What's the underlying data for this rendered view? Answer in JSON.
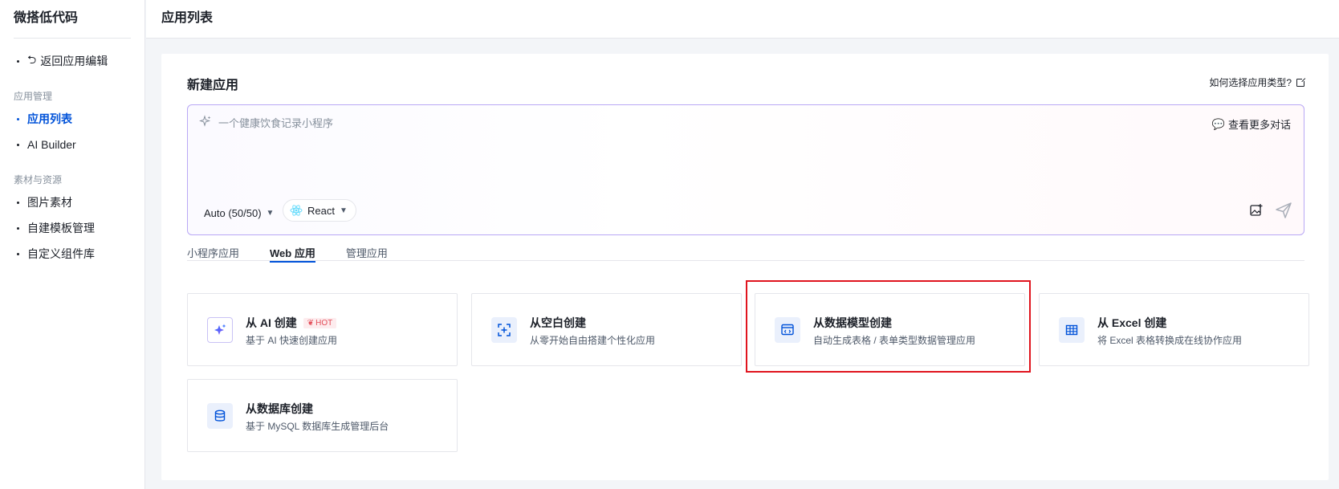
{
  "sidebar": {
    "brand": "微搭低代码",
    "back_label": "返回应用编辑",
    "section_app": "应用管理",
    "items_app": [
      {
        "label": "应用列表",
        "active": true
      },
      {
        "label": "AI Builder",
        "active": false
      }
    ],
    "section_assets": "素材与资源",
    "items_assets": [
      {
        "label": "图片素材"
      },
      {
        "label": "自建模板管理"
      },
      {
        "label": "自定义组件库"
      }
    ]
  },
  "header": {
    "title": "应用列表"
  },
  "main": {
    "title": "新建应用",
    "help_link": "如何选择应用类型?",
    "prompt": {
      "placeholder": "一个健康饮食记录小程序",
      "more_chats": "查看更多对话",
      "model": "Auto (50/50)",
      "framework": "React"
    },
    "tabs": [
      {
        "label": "小程序应用",
        "active": false
      },
      {
        "label": "Web 应用",
        "active": true
      },
      {
        "label": "管理应用",
        "active": false
      }
    ],
    "options": [
      {
        "title": "从 AI 创建",
        "badge": "HOT",
        "desc": "基于 AI 快速创建应用",
        "icon": "ai-sparkle-icon"
      },
      {
        "title": "从空白创建",
        "desc": "从零开始自由搭建个性化应用",
        "icon": "blank-canvas-icon"
      },
      {
        "title": "从数据模型创建",
        "desc": "自动生成表格 / 表单类型数据管理应用",
        "icon": "data-model-icon"
      },
      {
        "title": "从 Excel 创建",
        "desc": "将 Excel 表格转换成在线协作应用",
        "icon": "table-grid-icon"
      },
      {
        "title": "从数据库创建",
        "desc": "基于 MySQL 数据库生成管理后台",
        "icon": "database-icon"
      }
    ]
  },
  "colors": {
    "primary": "#0052d9",
    "highlight": "#e0141e",
    "hot_text": "#e34d59"
  }
}
